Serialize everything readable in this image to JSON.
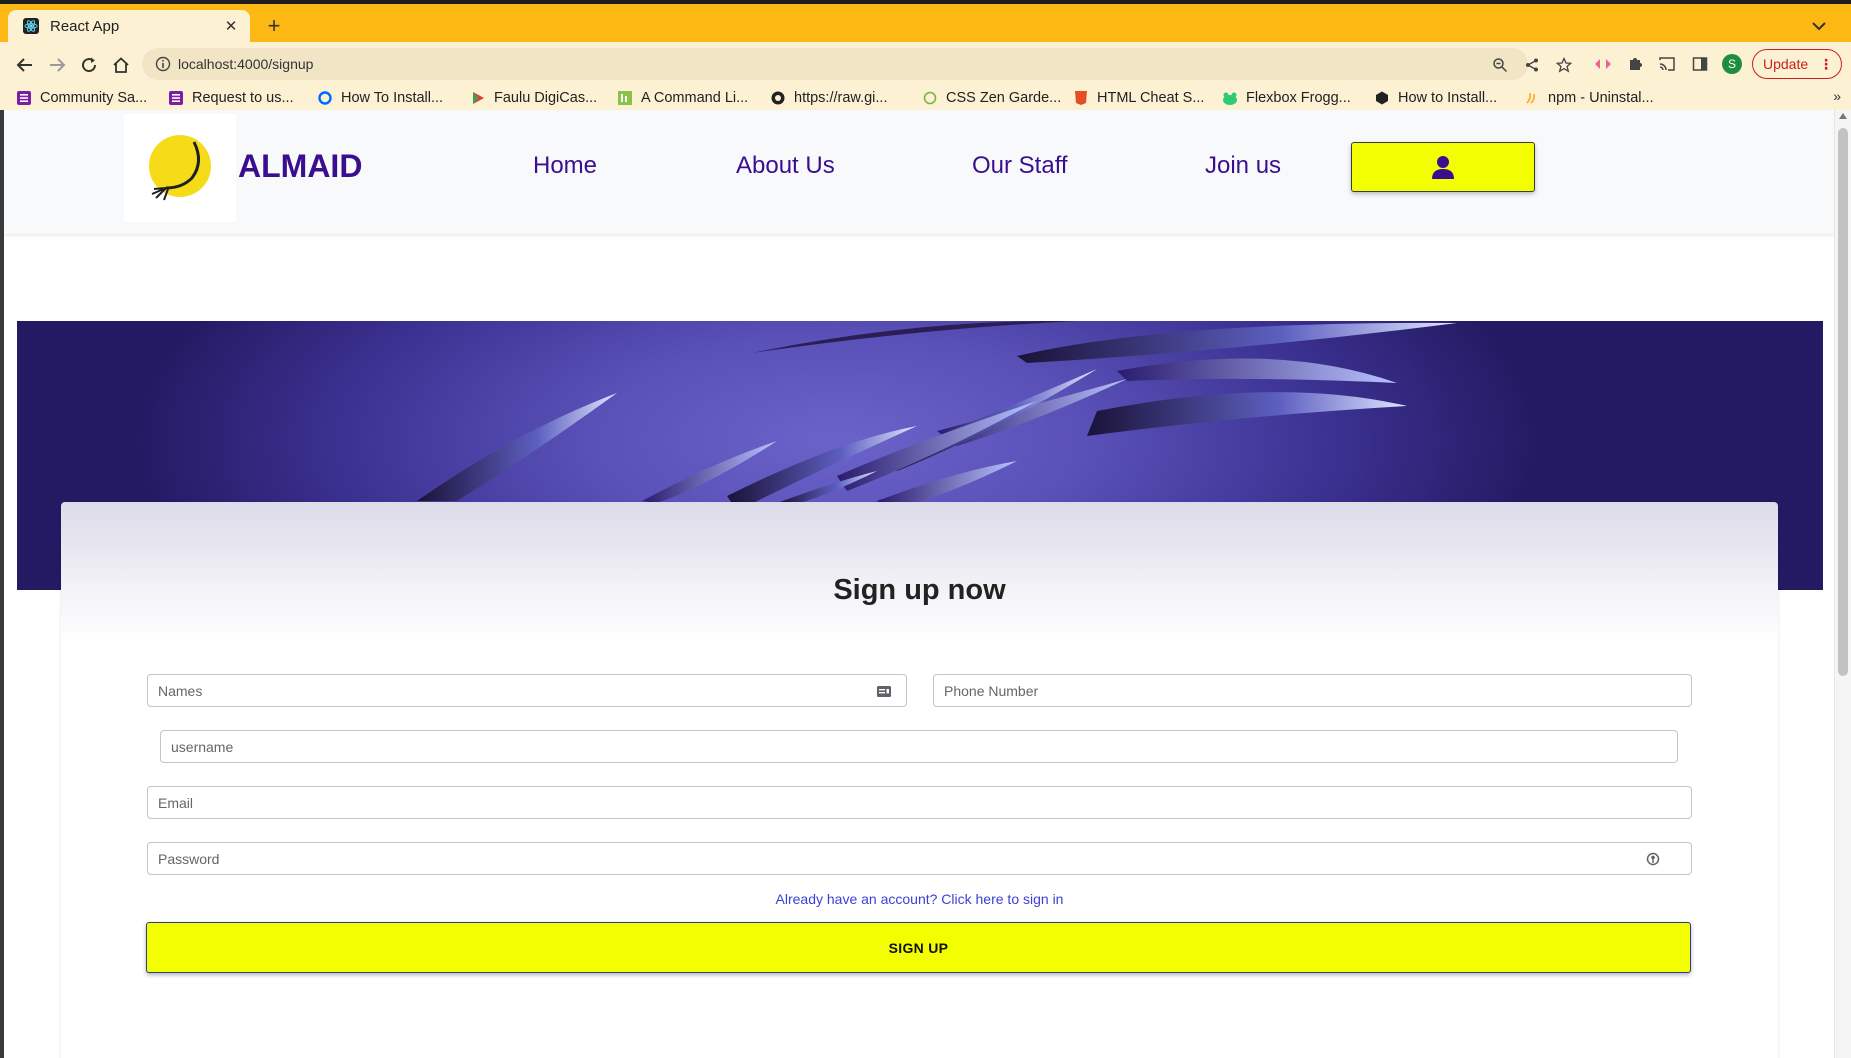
{
  "browser": {
    "tab_title": "React App",
    "url": "localhost:4000/signup",
    "profile_initial": "S",
    "update_label": "Update",
    "bookmarks": [
      {
        "label": "Community Sa...",
        "icon": "forms-icon"
      },
      {
        "label": "Request to us...",
        "icon": "forms-icon"
      },
      {
        "label": "How To Install...",
        "icon": "digitalocean-icon"
      },
      {
        "label": "Faulu DigiCas...",
        "icon": "play-store-icon"
      },
      {
        "label": "A Command Li...",
        "icon": "lh-icon"
      },
      {
        "label": "https://raw.gi...",
        "icon": "github-icon"
      },
      {
        "label": "CSS Zen Garde...",
        "icon": "zen-icon"
      },
      {
        "label": "HTML Cheat S...",
        "icon": "html5-icon"
      },
      {
        "label": "Flexbox Frogg...",
        "icon": "frog-icon"
      },
      {
        "label": "How to Install...",
        "icon": "hex-icon"
      },
      {
        "label": "npm - Uninstal...",
        "icon": "npm-icon"
      }
    ],
    "bookmarks_more": "»"
  },
  "site": {
    "brand": "ALMAID",
    "nav": [
      "Home",
      "About Us",
      "Our Staff",
      "Join us"
    ]
  },
  "form": {
    "title": "Sign up now",
    "names_placeholder": "Names",
    "phone_placeholder": "Phone Number",
    "username_placeholder": "username",
    "email_placeholder": "Email",
    "password_placeholder": "Password",
    "signin_link": "Already have an account? Click here to sign in",
    "submit_label": "SIGN UP"
  },
  "colors": {
    "brand_purple": "#3a0f8f",
    "accent_yellow": "#f3ff00",
    "chrome_orange": "#fdb813",
    "link_blue": "#3b41d6"
  }
}
